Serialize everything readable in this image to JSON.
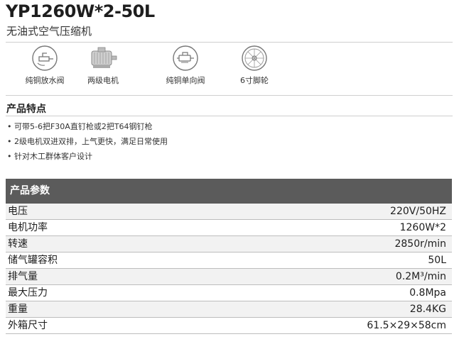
{
  "header": {
    "title": "YP1260W*2-50L",
    "subtitle": "无油式空气压缩机"
  },
  "features": [
    {
      "label": "纯铜放水阀",
      "icon": "drain-valve-icon"
    },
    {
      "label": "两级电机",
      "icon": "motor-icon"
    },
    {
      "label": "纯铜单向阀",
      "icon": "check-valve-icon"
    },
    {
      "label": "6寸脚轮",
      "icon": "caster-wheel-icon"
    }
  ],
  "highlights": {
    "title": "产品特点",
    "items": [
      "可带5-6把F30A直钉枪或2把T64钢钉枪",
      "2级电机双进双排，上气更快，满足日常使用",
      "针对木工群体客户设计"
    ]
  },
  "specs": {
    "title": "产品参数",
    "rows": [
      {
        "label": "电压",
        "value": "220V/50HZ"
      },
      {
        "label": "电机功率",
        "value": "1260W*2"
      },
      {
        "label": "转速",
        "value": "2850r/min"
      },
      {
        "label": "储气罐容积",
        "value": "50L"
      },
      {
        "label": "排气量",
        "value": "0.2M³/min"
      },
      {
        "label": "最大压力",
        "value": "0.8Mpa"
      },
      {
        "label": "重量",
        "value": "28.4KG"
      },
      {
        "label": "外箱尺寸",
        "value": "61.5×29×58cm"
      }
    ]
  }
}
